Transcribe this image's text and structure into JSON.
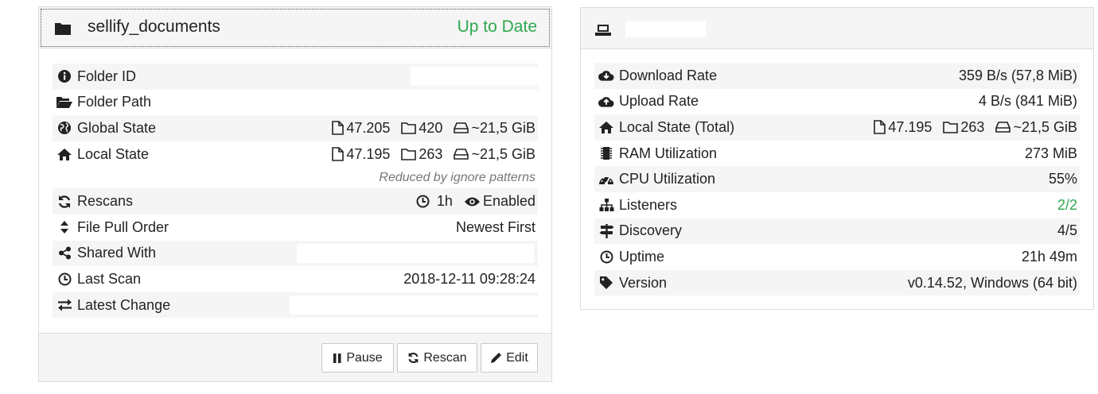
{
  "folder": {
    "title": "sellify_documents",
    "status": "Up to Date",
    "status_color": "#2fa84f",
    "rows": {
      "folder_id": {
        "label": "Folder ID",
        "icon": "info-circle-icon"
      },
      "folder_path": {
        "label": "Folder Path",
        "icon": "folder-open-icon"
      },
      "global_state": {
        "label": "Global State",
        "icon": "globe-icon",
        "files": "47.205",
        "dirs": "420",
        "size": "~21,5 GiB"
      },
      "local_state": {
        "label": "Local State",
        "icon": "home-icon",
        "files": "47.195",
        "dirs": "263",
        "size": "~21,5 GiB"
      },
      "ignore_note": "Reduced by ignore patterns",
      "rescans": {
        "label": "Rescans",
        "icon": "refresh-icon",
        "interval": "1h",
        "watcher": "Enabled"
      },
      "pull_order": {
        "label": "File Pull Order",
        "icon": "sort-icon",
        "value": "Newest First"
      },
      "shared_with": {
        "label": "Shared With",
        "icon": "share-icon"
      },
      "last_scan": {
        "label": "Last Scan",
        "icon": "clock-icon",
        "value": "2018-12-11 09:28:24"
      },
      "latest_change": {
        "label": "Latest Change",
        "icon": "exchange-icon"
      }
    },
    "buttons": {
      "pause": "Pause",
      "rescan": "Rescan",
      "edit": "Edit"
    }
  },
  "device": {
    "header_icon": "laptop-icon",
    "rows": {
      "download_rate": {
        "label": "Download Rate",
        "icon": "cloud-download-icon",
        "value": "359 B/s (57,8 MiB)"
      },
      "upload_rate": {
        "label": "Upload Rate",
        "icon": "cloud-upload-icon",
        "value": "4 B/s (841 MiB)"
      },
      "local_state_total": {
        "label": "Local State (Total)",
        "icon": "home-icon",
        "files": "47.195",
        "dirs": "263",
        "size": "~21,5 GiB"
      },
      "ram": {
        "label": "RAM Utilization",
        "icon": "memory-icon",
        "value": "273 MiB"
      },
      "cpu": {
        "label": "CPU Utilization",
        "icon": "dashboard-icon",
        "value": "55%"
      },
      "listeners": {
        "label": "Listeners",
        "icon": "sitemap-icon",
        "value": "2/2",
        "value_color": "#2fa84f"
      },
      "discovery": {
        "label": "Discovery",
        "icon": "signpost-icon",
        "value": "4/5"
      },
      "uptime": {
        "label": "Uptime",
        "icon": "clock-icon",
        "value": "21h 49m"
      },
      "version": {
        "label": "Version",
        "icon": "tag-icon",
        "value": "v0.14.52, Windows (64 bit)"
      }
    }
  }
}
